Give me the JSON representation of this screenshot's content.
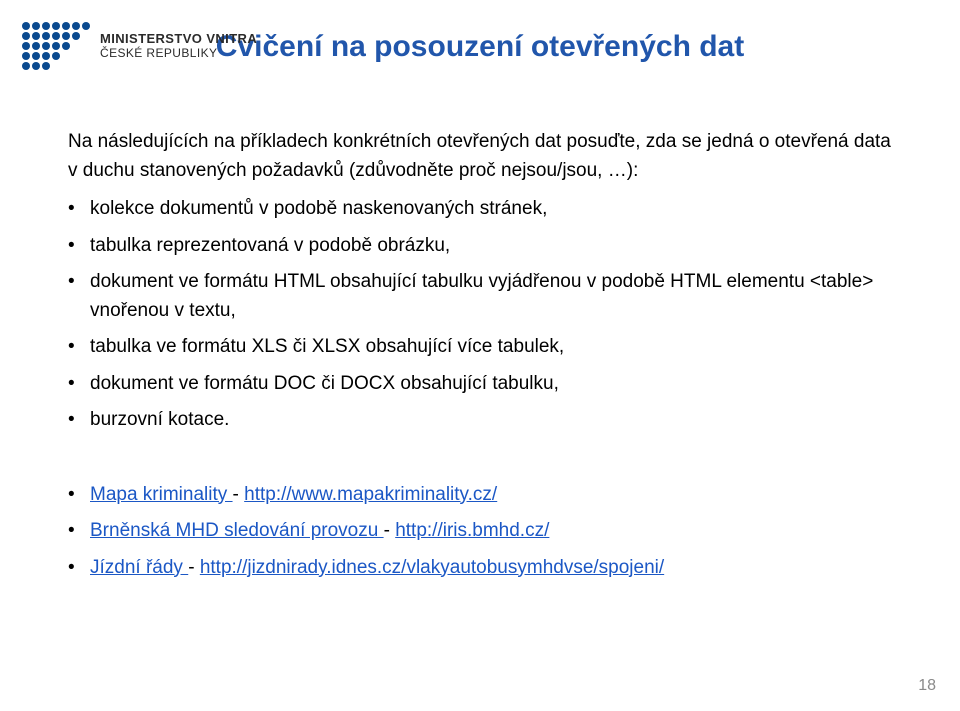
{
  "logo": {
    "wordmark": "MINISTERSTVO VNITRA",
    "subtitle": "ČESKÉ REPUBLIKY"
  },
  "title": "Cvičení na posouzení otevřených dat",
  "lead": "Na následujících na příkladech konkrétních otevřených dat posuďte, zda se jedná o otevřená data v duchu stanovených požadavků (zdůvodněte proč nejsou/jsou, …):",
  "bullets": [
    "kolekce dokumentů v podobě naskenovaných stránek,",
    "tabulka reprezentovaná v podobě obrázku,",
    "dokument ve formátu HTML obsahující tabulku vyjádřenou v podobě HTML elementu <table> vnořenou v textu,",
    "tabulka ve formátu XLS či XLSX obsahující více tabulek,",
    "dokument ve formátu DOC či DOCX obsahující tabulku,",
    "burzovní kotace."
  ],
  "links": [
    {
      "label": "Mapa kriminality ",
      "sep": "-",
      "url_text": "http://www.mapakriminality.cz/"
    },
    {
      "label": "Brněnská MHD sledování provozu ",
      "sep": "-",
      "url_text": "http://iris.bmhd.cz/"
    },
    {
      "label": "Jízdní řády ",
      "sep": "-",
      "url_text": "http://jizdnirady.idnes.cz/vlakyautobusymhdvse/spojeni/"
    }
  ],
  "page_number": "18"
}
